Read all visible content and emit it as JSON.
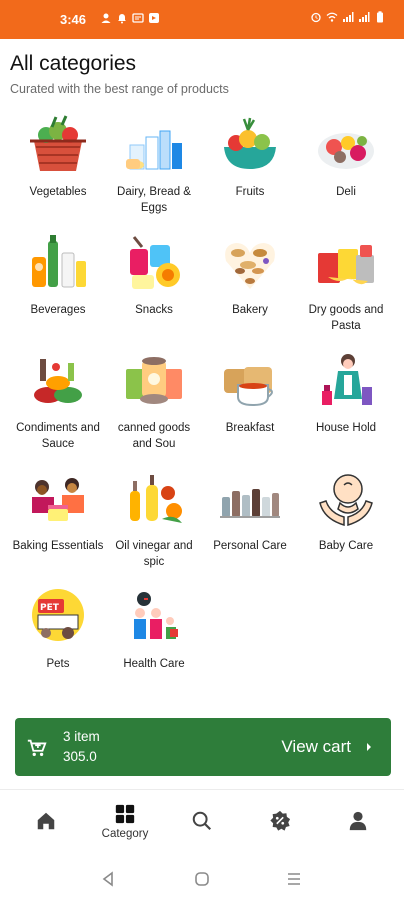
{
  "status_bar": {
    "time": "3:46",
    "background": "#f26a1b",
    "left_icons": [
      "person-icon",
      "notification-bell-icon",
      "message-icon",
      "app-icon"
    ],
    "right_icons": [
      "alarm-icon",
      "wifi-icon",
      "signal-icon",
      "signal-icon",
      "battery-icon"
    ]
  },
  "header": {
    "title": "All categories",
    "subtitle": "Curated with the best range of products"
  },
  "categories": [
    {
      "label": "Vegetables",
      "icon": "vegetable-basket-icon"
    },
    {
      "label": "Dairy, Bread & Eggs",
      "icon": "dairy-products-icon"
    },
    {
      "label": "Fruits",
      "icon": "fruit-bowl-icon"
    },
    {
      "label": "Deli",
      "icon": "deli-platter-icon"
    },
    {
      "label": "Beverages",
      "icon": "beverages-icon"
    },
    {
      "label": "Snacks",
      "icon": "snacks-icon"
    },
    {
      "label": "Bakery",
      "icon": "bakery-icon"
    },
    {
      "label": "Dry goods and Pasta",
      "icon": "pasta-icon"
    },
    {
      "label": "Condiments and Sauce",
      "icon": "condiments-icon"
    },
    {
      "label": "canned goods and Sou",
      "icon": "canned-goods-icon"
    },
    {
      "label": "Breakfast",
      "icon": "breakfast-icon"
    },
    {
      "label": "House Hold",
      "icon": "household-icon"
    },
    {
      "label": "Baking Essentials",
      "icon": "baking-icon"
    },
    {
      "label": "Oil vinegar and spic",
      "icon": "oil-vinegar-icon"
    },
    {
      "label": "Personal Care",
      "icon": "personal-care-icon"
    },
    {
      "label": "Baby Care",
      "icon": "baby-care-icon"
    },
    {
      "label": "Pets",
      "icon": "pet-shop-icon"
    },
    {
      "label": "Health Care",
      "icon": "health-care-icon"
    }
  ],
  "cart": {
    "item_count": "3 item",
    "total": "305.0",
    "action_label": "View cart",
    "background": "#2e7d3a"
  },
  "bottom_nav": [
    {
      "name": "home",
      "label": "",
      "icon": "home-icon"
    },
    {
      "name": "category",
      "label": "Category",
      "icon": "category-grid-icon",
      "active": true
    },
    {
      "name": "search",
      "label": "",
      "icon": "search-icon"
    },
    {
      "name": "offers",
      "label": "",
      "icon": "offer-badge-icon"
    },
    {
      "name": "profile",
      "label": "",
      "icon": "profile-icon"
    }
  ],
  "system_nav": [
    "back-icon",
    "home-circle-icon",
    "recents-icon"
  ]
}
